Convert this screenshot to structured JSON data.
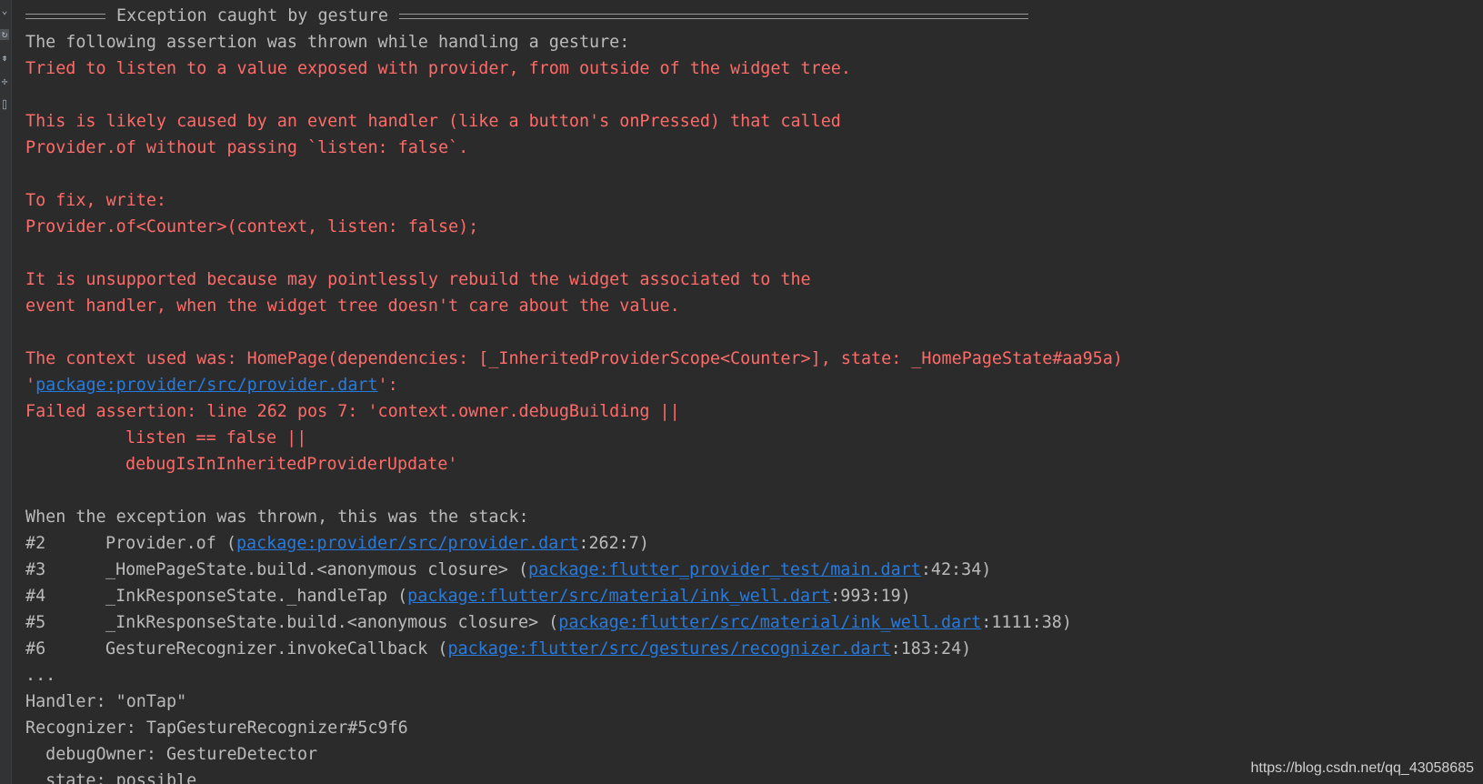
{
  "gutter": {
    "icons": [
      {
        "name": "collapse-icon",
        "glyph": "⌄"
      },
      {
        "name": "restart-icon",
        "glyph": "↻"
      },
      {
        "name": "print-icon",
        "glyph": "⇟"
      },
      {
        "name": "pin-icon",
        "glyph": "✢"
      },
      {
        "name": "trash-icon",
        "glyph": "⌷"
      }
    ]
  },
  "console": {
    "header": "Exception caught by gesture",
    "assertion_intro": "The following assertion was thrown while handling a gesture:",
    "error_lines": [
      "Tried to listen to a value exposed with provider, from outside of the widget tree.",
      "This is likely caused by an event handler (like a button's onPressed) that called",
      "Provider.of without passing `listen: false`.",
      "To fix, write:",
      "Provider.of<Counter>(context, listen: false);",
      "It is unsupported because may pointlessly rebuild the widget associated to the",
      "event handler, when the widget tree doesn't care about the value.",
      "The context used was: HomePage(dependencies: [_InheritedProviderScope<Counter>], state: _HomePageState#aa95a)"
    ],
    "assert_source": {
      "quote_open": "'",
      "link": "package:provider/src/provider.dart",
      "quote_close": "':"
    },
    "failed_assertion": [
      "Failed assertion: line 262 pos 7: 'context.owner.debugBuilding ||",
      "listen == false ||",
      "debugIsInInheritedProviderUpdate'"
    ],
    "stack_intro": "When the exception was thrown, this was the stack:",
    "stack": [
      {
        "num": "#2",
        "method": "Provider.of (",
        "link": "package:provider/src/provider.dart",
        "pos": ":262:7)"
      },
      {
        "num": "#3",
        "method": "_HomePageState.build.<anonymous closure> (",
        "link": "package:flutter_provider_test/main.dart",
        "pos": ":42:34)"
      },
      {
        "num": "#4",
        "method": "_InkResponseState._handleTap (",
        "link": "package:flutter/src/material/ink_well.dart",
        "pos": ":993:19)"
      },
      {
        "num": "#5",
        "method": "_InkResponseState.build.<anonymous closure> (",
        "link": "package:flutter/src/material/ink_well.dart",
        "pos": ":1111:38)"
      },
      {
        "num": "#6",
        "method": "GestureRecognizer.invokeCallback (",
        "link": "package:flutter/src/gestures/recognizer.dart",
        "pos": ":183:24)"
      }
    ],
    "ellipsis": "...",
    "handler": "Handler: \"onTap\"",
    "recognizer": "Recognizer: TapGestureRecognizer#5c9f6",
    "debug_owner": "  debugOwner: GestureDetector",
    "state": "  state: possible"
  },
  "watermark": "https://blog.csdn.net/qq_43058685",
  "colors": {
    "background": "#2b2b2b",
    "error": "#ff6b68",
    "text": "#bbbbbb",
    "link": "#287bde"
  }
}
